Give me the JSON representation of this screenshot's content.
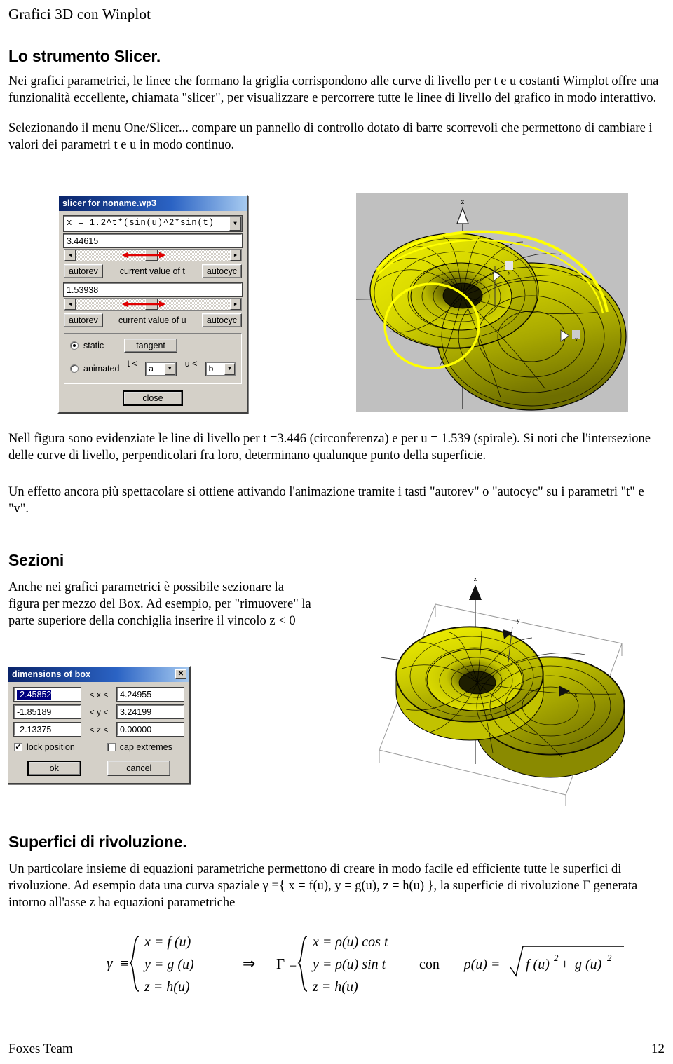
{
  "document": {
    "header": "Grafici 3D con Winplot",
    "footer_left": "Foxes Team",
    "footer_page": "12"
  },
  "sections": [
    {
      "heading": "Lo strumento Slicer.",
      "paragraphs": [
        "Nei grafici parametrici, le linee che formano la griglia corrispondono alle curve di livello per t e u costanti Wimplot offre una funzionalità eccellente, chiamata \"slicer\", per visualizzare e percorrere tutte le linee di livello del grafico in modo interattivo.",
        "Selezionando il menu One/Slicer... compare un pannello di controllo dotato di barre scorrevoli che permettono di cambiare i valori dei parametri t e u in modo continuo.",
        "Nell figura sono evidenziate le line di livello per t =3.446 (circonferenza) e per u = 1.539 (spirale). Si noti che l'intersezione delle curve di livello, perpendicolari fra loro, determinano qualunque punto della superficie.",
        "Un effetto ancora più spettacolare si ottiene attivando l'animazione tramite i tasti \"autorev\" o \"autocyc\" su i parametri \"t\" e \"v\"."
      ]
    },
    {
      "heading": "Sezioni",
      "paragraphs": [
        "Anche nei grafici parametrici è possibile sezionare la figura per mezzo del Box. Ad esempio, per \"rimuovere\" la parte superiore della conchiglia inserire il vincolo z < 0"
      ]
    },
    {
      "heading": "Superfici di rivoluzione.",
      "paragraphs": [
        "Un particolare insieme di equazioni parametriche permettono di creare in modo facile ed efficiente tutte le superfici di rivoluzione. Ad esempio data una curva spaziale γ ≡{ x = f(u), y = g(u), z = h(u) }, la superficie di rivoluzione Γ generata intorno all'asse z ha equazioni parametriche"
      ]
    }
  ],
  "slicer_dialog": {
    "title": "slicer for noname.wp3",
    "equation": "x = 1.2^t*(sin(u)^2*sin(t)",
    "t_value": "3.44615",
    "t_label": "current value of t",
    "u_value": "1.53938",
    "u_label": "current value of u",
    "autorev_label": "autorev",
    "autocyc_label": "autocyc",
    "static_label": "static",
    "animated_label": "animated",
    "tangent_label": "tangent",
    "t_arrow_label": "t <--",
    "t_animate_var": "a",
    "u_arrow_label": "u <--",
    "u_animate_var": "b",
    "close_label": "close",
    "scroll_left_glyph": "◄",
    "scroll_right_glyph": "►",
    "combo_arrow_glyph": "▼"
  },
  "box_dialog": {
    "title": "dimensions of box",
    "close_glyph": "✕",
    "rows": [
      {
        "min": "-2.45852",
        "op": "< x <",
        "max": "4.24955",
        "selected": true
      },
      {
        "min": "-1.85189",
        "op": "< y <",
        "max": "3.24199",
        "selected": false
      },
      {
        "min": "-2.13375",
        "op": "< z <",
        "max": "0.00000",
        "selected": false
      }
    ],
    "lock_position_label": "lock position",
    "lock_position_checked": true,
    "cap_extremes_label": "cap extremes",
    "cap_extremes_checked": false,
    "ok_label": "ok",
    "cancel_label": "cancel",
    "check_glyph": "✓"
  },
  "plots": [
    {
      "name": "shell-surface-with-level-curves",
      "background": "#c0c0c0",
      "surface_color": "#d8d800",
      "highlight_color": "#ffff00",
      "axis_labels": [
        "z",
        "y",
        "x"
      ]
    },
    {
      "name": "shell-surface-sectioned",
      "background": "#ffffff",
      "surface_color": "#d8d800",
      "axis_labels": [
        "z",
        "y",
        "x"
      ]
    }
  ],
  "formula": {
    "gamma": "γ",
    "equiv": "≡",
    "gamma_rows": [
      "x = f (u)",
      "y = g (u)",
      "z = h(u)"
    ],
    "implies": "⇒",
    "bigGamma": "Γ",
    "bigGamma_rows": [
      "x = ρ(u) cos t",
      "y = ρ(u) sin t",
      "z = h(u)"
    ],
    "con": "con",
    "rho_def_lhs": "ρ(u) =",
    "rho_def_radicand": "f (u)² + g (u)²"
  }
}
